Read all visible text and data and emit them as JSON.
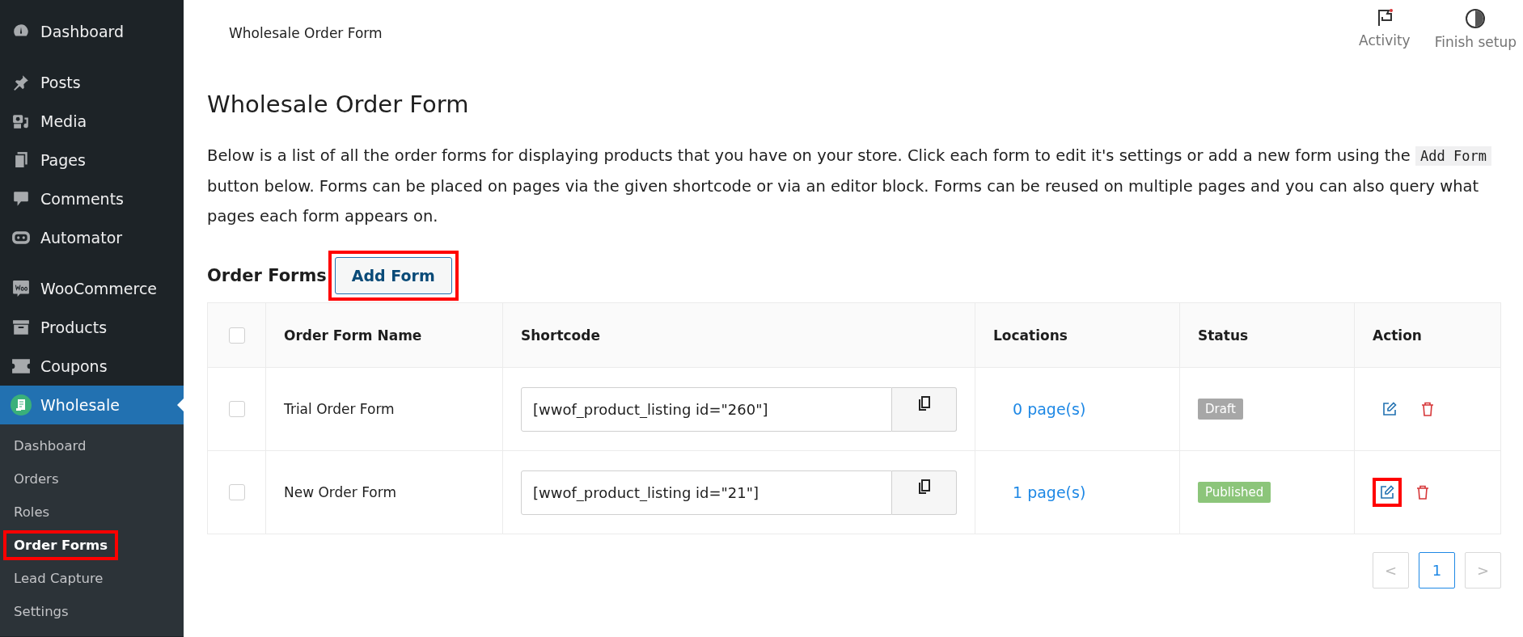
{
  "sidebar": {
    "groups": [
      [
        {
          "label": "Dashboard",
          "selected": false
        }
      ],
      [
        {
          "label": "Posts",
          "selected": false
        },
        {
          "label": "Media",
          "selected": false
        },
        {
          "label": "Pages",
          "selected": false
        },
        {
          "label": "Comments",
          "selected": false
        },
        {
          "label": "Automator",
          "selected": false
        }
      ],
      [
        {
          "label": "WooCommerce",
          "selected": false
        },
        {
          "label": "Products",
          "selected": false
        },
        {
          "label": "Coupons",
          "selected": false
        },
        {
          "label": "Wholesale",
          "selected": true
        }
      ]
    ],
    "submenu": [
      {
        "label": "Dashboard",
        "selected": false,
        "highlighted": false
      },
      {
        "label": "Orders",
        "selected": false,
        "highlighted": false
      },
      {
        "label": "Roles",
        "selected": false,
        "highlighted": false
      },
      {
        "label": "Order Forms",
        "selected": true,
        "highlighted": true
      },
      {
        "label": "Lead Capture",
        "selected": false,
        "highlighted": false
      },
      {
        "label": "Settings",
        "selected": false,
        "highlighted": false
      }
    ]
  },
  "top_bar": {
    "title": "Wholesale Order Form",
    "actions": [
      {
        "label": "Activity"
      },
      {
        "label": "Finish setup"
      }
    ]
  },
  "page": {
    "heading": "Wholesale Order Form",
    "description": [
      {
        "kind": "text",
        "text": "Below is a list of all the order forms for displaying products that you have on your store. Click each form to edit it's settings or add a new form using the "
      },
      {
        "kind": "code",
        "text": "Add Form"
      },
      {
        "kind": "text",
        "text": " button below. Forms can be placed on pages via the given shortcode or via an editor block. Forms can be reused on multiple pages and you can also query what pages each form appears on."
      }
    ],
    "section_title": "Order Forms",
    "add_button": {
      "label": "Add Form",
      "highlighted": true
    }
  },
  "table": {
    "select_all_checked": false,
    "columns": [
      "Order Form Name",
      "Shortcode",
      "Locations",
      "Status",
      "Action"
    ],
    "rows": [
      {
        "checked": false,
        "name": "Trial Order Form",
        "shortcode": "[wwof_product_listing id=\"260\"]",
        "locations": "0 page(s)",
        "status": {
          "label": "Draft",
          "color": "#a7a7a7"
        },
        "edit_highlighted": false
      },
      {
        "checked": false,
        "name": "New Order Form",
        "shortcode": "[wwof_product_listing id=\"21\"]",
        "locations": "1 page(s)",
        "status": {
          "label": "Published",
          "color": "#8cc57a"
        },
        "edit_highlighted": true
      }
    ]
  },
  "pagination": {
    "prev": "<",
    "next": ">",
    "pages": [
      {
        "label": "1",
        "selected": true
      }
    ]
  }
}
